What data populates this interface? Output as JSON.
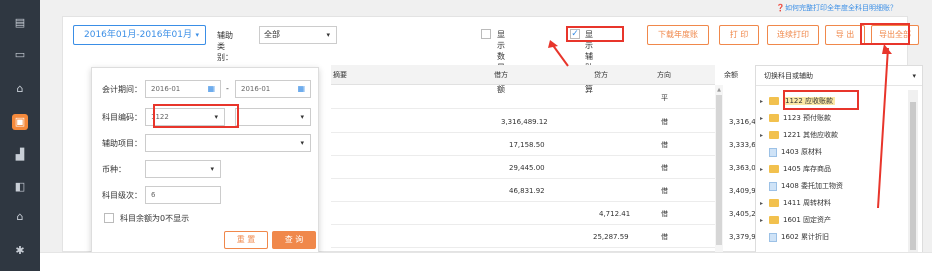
{
  "sidebar": {
    "icons": [
      "document-icon",
      "card-icon",
      "ledger-icon",
      "report-icon",
      "chart-icon",
      "export-icon",
      "home-icon",
      "settings-icon"
    ]
  },
  "help_link": "❓如何完整打印全年度全科目明细账？",
  "toolbar": {
    "date_range": "2016年01月-2016年01月",
    "aux_category_label": "辅助类别：",
    "aux_category_value": "全部",
    "show_qty_label": "显示数量金额",
    "show_qty_checked": false,
    "show_aux_label": "显示辅助核算",
    "show_aux_checked": true,
    "buttons": [
      "下载年度账",
      "打 印",
      "连续打印",
      "导 出",
      "导出全部"
    ]
  },
  "table": {
    "headers": [
      "摘要",
      "借方",
      "贷方",
      "方向",
      "余额"
    ],
    "rows": [
      {
        "summary": "",
        "debit": "",
        "credit": "",
        "direction": "平",
        "balance": ""
      },
      {
        "summary": "",
        "debit": "3,316,489.12",
        "credit": "",
        "direction": "借",
        "balance": "3,316,489.12"
      },
      {
        "summary": "",
        "debit": "17,158.50",
        "credit": "",
        "direction": "借",
        "balance": "3,333,647.62"
      },
      {
        "summary": "",
        "debit": "29,445.00",
        "credit": "",
        "direction": "借",
        "balance": "3,363,092.62"
      },
      {
        "summary": "",
        "debit": "46,831.92",
        "credit": "",
        "direction": "借",
        "balance": "3,409,924.54"
      },
      {
        "summary": "",
        "debit": "",
        "credit": "4,712.41",
        "direction": "借",
        "balance": "3,405,212.13"
      },
      {
        "summary": "",
        "debit": "",
        "credit": "25,287.59",
        "direction": "借",
        "balance": "3,379,924.54"
      }
    ]
  },
  "filter_panel": {
    "period_label": "会计期间：",
    "period_start": "2016-01",
    "period_end": "2016-01",
    "period_sep": "-",
    "account_code_label": "科目编码：",
    "account_code_value": "1122",
    "account_code_second": "",
    "aux_item_label": "辅助项目：",
    "aux_item_value": "",
    "currency_label": "币种：",
    "currency_value": "",
    "level_label": "科目级次：",
    "level_value": "6",
    "zero_balance_label": "科目余额为0不显示",
    "reset_label": "重 置",
    "query_label": "查 询"
  },
  "tree": {
    "header": "切换科目或辅助",
    "items": [
      {
        "label": "1122 应收账款",
        "type": "folder",
        "expandable": true,
        "highlighted": true
      },
      {
        "label": "1123 预付账款",
        "type": "folder",
        "expandable": true
      },
      {
        "label": "1221 其他应收款",
        "type": "folder",
        "expandable": true
      },
      {
        "label": "1403 原材料",
        "type": "file",
        "expandable": false
      },
      {
        "label": "1405 库存商品",
        "type": "folder",
        "expandable": true
      },
      {
        "label": "1408 委托加工物资",
        "type": "file",
        "expandable": false
      },
      {
        "label": "1411 周转材料",
        "type": "folder",
        "expandable": true
      },
      {
        "label": "1601 固定资产",
        "type": "folder",
        "expandable": true
      },
      {
        "label": "1602 累计折旧",
        "type": "file",
        "expandable": false
      }
    ]
  },
  "colors": {
    "accent_blue": "#3a8ee6",
    "accent_orange": "#f0884b",
    "annotation_red": "#e8352b",
    "sidebar_bg": "#2f3741"
  }
}
